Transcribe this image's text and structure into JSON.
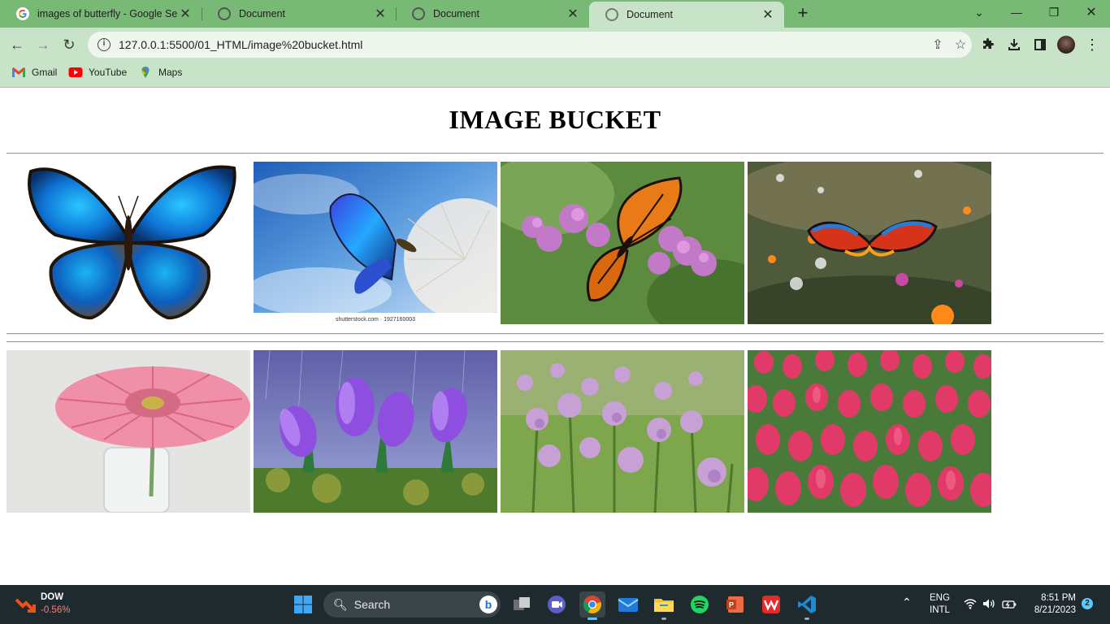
{
  "browser": {
    "tabs": [
      {
        "title": "images of butterfly - Google Sear",
        "favicon": "google-icon",
        "active": false
      },
      {
        "title": "Document",
        "favicon": "globe-icon",
        "active": false
      },
      {
        "title": "Document",
        "favicon": "globe-icon",
        "active": false
      },
      {
        "title": "Document",
        "favicon": "globe-icon",
        "active": true
      }
    ],
    "url": "127.0.0.1:5500/01_HTML/image%20bucket.html",
    "bookmarks": [
      {
        "label": "Gmail",
        "icon": "gmail-icon"
      },
      {
        "label": "YouTube",
        "icon": "youtube-icon"
      },
      {
        "label": "Maps",
        "icon": "maps-icon"
      }
    ],
    "theme": {
      "tab_strip": "#77b975",
      "toolbar": "#c8e3c7"
    }
  },
  "page": {
    "title": "IMAGE BUCKET",
    "row1": [
      {
        "subject": "blue morpho butterfly on white",
        "caption": ""
      },
      {
        "subject": "blue butterfly on dandelion, sky background",
        "caption": "shutterstock.com · 1927160003"
      },
      {
        "subject": "monarch butterfly on purple flowers",
        "caption": ""
      },
      {
        "subject": "colorful butterfly over wildflower meadow",
        "caption": ""
      }
    ],
    "row2": [
      {
        "subject": "pink gerbera in glass vase",
        "caption": ""
      },
      {
        "subject": "purple crocuses in rain",
        "caption": ""
      },
      {
        "subject": "purple chive flowers",
        "caption": ""
      },
      {
        "subject": "field of red tulips",
        "caption": ""
      }
    ]
  },
  "taskbar": {
    "ticker": {
      "name": "DOW",
      "change": "-0.56%"
    },
    "search_label": "Search",
    "apps": [
      "windows-start-icon",
      "task-view-icon",
      "meet-icon",
      "chrome-icon",
      "mail-icon",
      "file-explorer-icon",
      "spotify-icon",
      "powerpoint-icon",
      "wps-icon",
      "vscode-icon"
    ],
    "language": "ENG",
    "layout": "INTL",
    "time": "8:51 PM",
    "date": "8/21/2023",
    "notifications": "2"
  }
}
